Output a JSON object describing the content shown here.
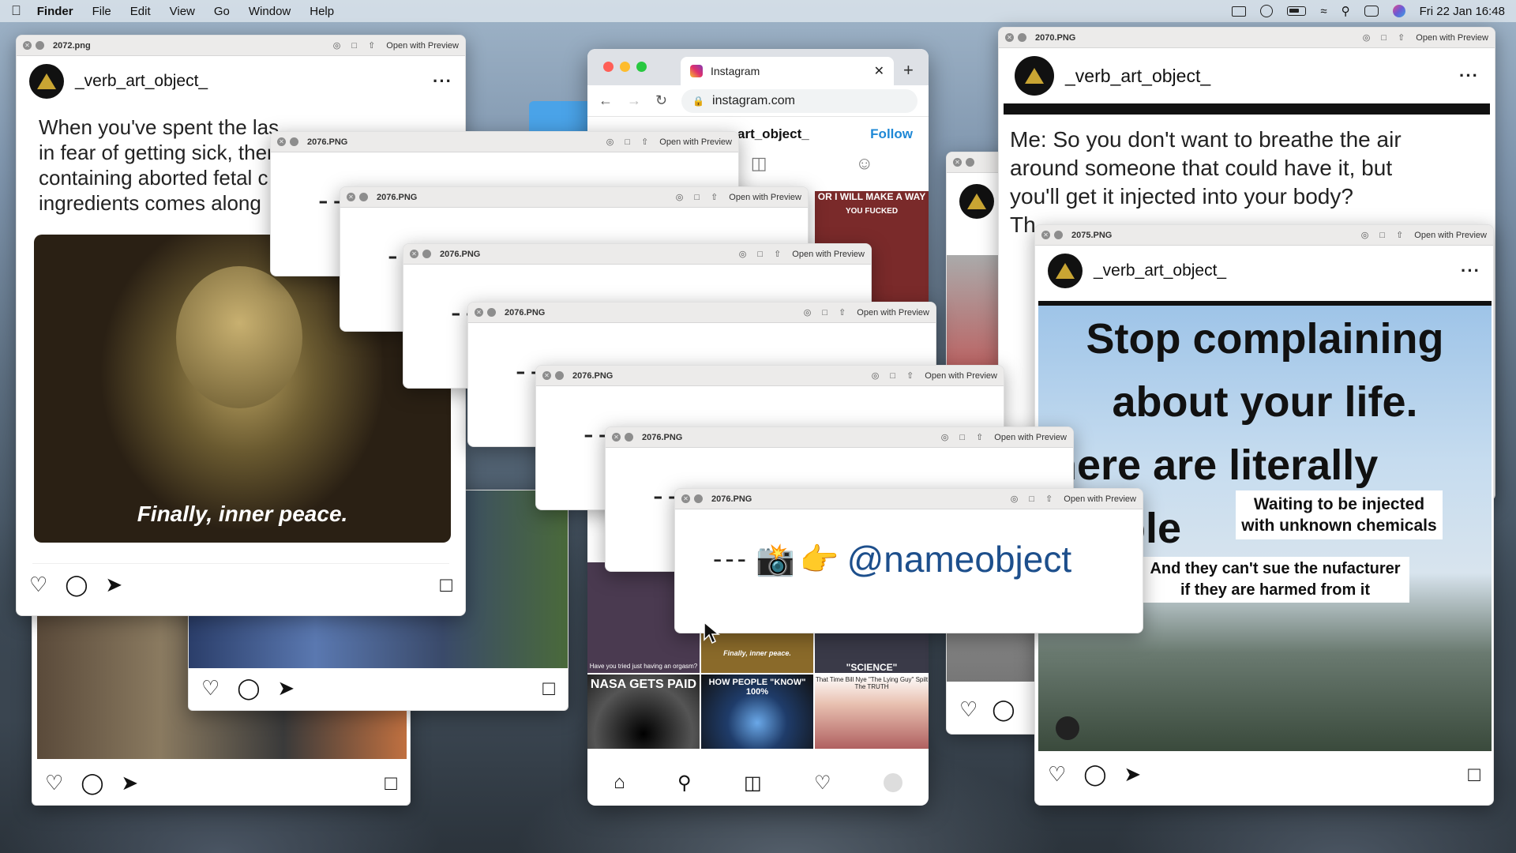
{
  "menubar": {
    "app": "Finder",
    "menus": [
      "File",
      "Edit",
      "View",
      "Go",
      "Window",
      "Help"
    ],
    "datetime": "Fri 22 Jan  16:48"
  },
  "ql_common": {
    "open_with": "Open with Preview"
  },
  "win_2072": {
    "filename": "2072.png",
    "username": "_verb_art_object_",
    "caption_lines": [
      "When you've spent the las",
      "in fear of getting sick, ther",
      "containing aborted fetal c",
      "ingredients comes along"
    ],
    "image_text": "Finally, inner peace."
  },
  "win_2070": {
    "filename": "2070.PNG",
    "username": "_verb_art_object_",
    "caption_lines": [
      "Me: So you don't want to breathe the air",
      "around someone that could have it, but",
      "you'll get it injected into your body?",
      "Th"
    ]
  },
  "win_2075": {
    "filename": "2075.PNG",
    "username": "_verb_art_object_",
    "headline": [
      "Stop complaining",
      "about your life.",
      "here are literally",
      "ople"
    ],
    "box1": "Waiting to be injected with unknown chemicals",
    "box2": "And they can't sue the nufacturer if they are harmed from it"
  },
  "stack": {
    "filename": "2076.PNG",
    "dash": "--",
    "front_text": "@nameobject",
    "front_prefix": "---"
  },
  "browser": {
    "tab_title": "Instagram",
    "url": "instagram.com",
    "profile_partial": "art_object_",
    "follow": "Follow",
    "grid": [
      {
        "text": "OR I WILL MAKE A WAY",
        "color": "#7a2a2a"
      },
      {
        "text": "YOU FUCKED",
        "color": "#5a3a1a"
      },
      {
        "text": "Have you tried just having an orgasm?",
        "color": "#4a3a50"
      },
      {
        "text": "Finally, inner peace.",
        "color": "#8a6a2a"
      },
      {
        "text": "\"SCIENCE\"",
        "color": "#3a3a48"
      },
      {
        "text": "NASA GETS PAID",
        "color": "#222"
      },
      {
        "text": "HOW PEOPLE \"KNOW\" 100%",
        "color": "#1f3c6a"
      },
      {
        "text": "That Time Bill Nye \"The Lying Guy\" Spilt The TRUTH",
        "color": "#b04040"
      }
    ]
  },
  "bottom_left": {
    "cards": 2
  }
}
